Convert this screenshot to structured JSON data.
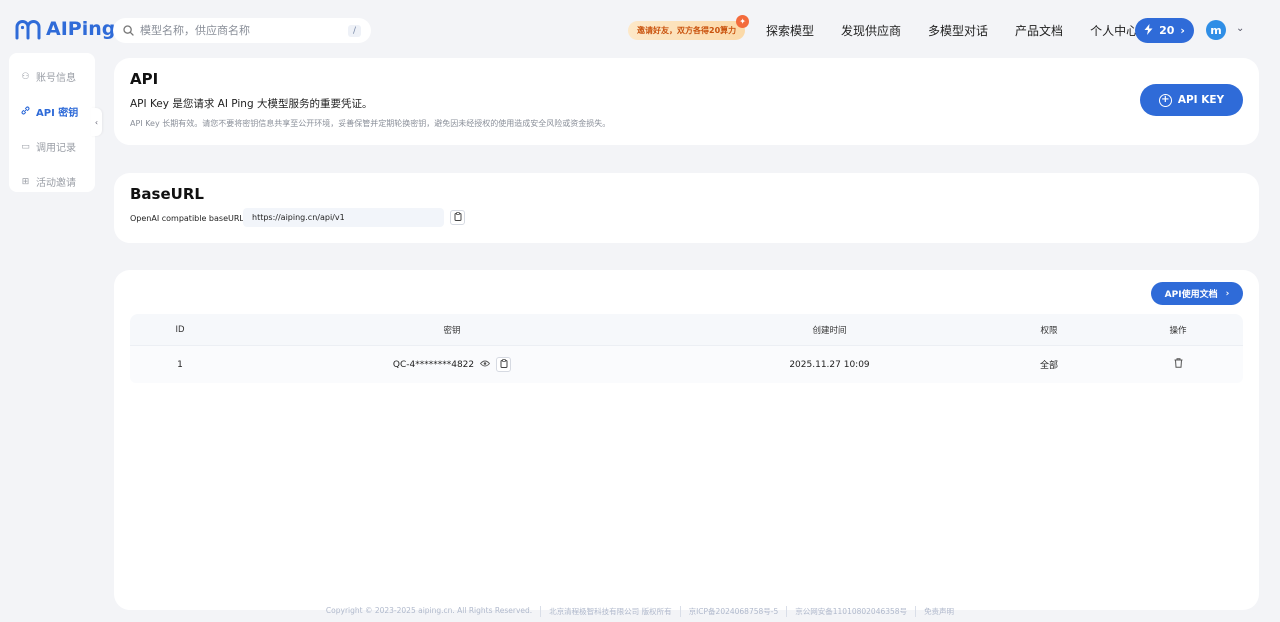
{
  "header": {
    "logo_text": "AIPing",
    "search_placeholder": "模型名称，供应商名称",
    "search_shortcut": "/",
    "promo": "邀请好友，双方各得20算力",
    "nav": [
      "探索模型",
      "发现供应商",
      "多模型对话",
      "产品文档",
      "个人中心"
    ],
    "credits": "20",
    "avatar_letter": "m"
  },
  "sidebar": {
    "items": [
      {
        "label": "账号信息",
        "icon": "users-icon"
      },
      {
        "label": "API 密钥",
        "icon": "link-icon"
      },
      {
        "label": "调用记录",
        "icon": "document-icon"
      },
      {
        "label": "活动邀请",
        "icon": "gift-icon"
      }
    ]
  },
  "api_card": {
    "title": "API",
    "description": "API Key 是您请求 AI Ping 大模型服务的重要凭证。",
    "note": "API Key 长期有效。请您不要将密钥信息共享至公开环境，妥善保管并定期轮换密钥，避免因未经授权的使用造成安全风险或资金损失。",
    "button_label": "API KEY"
  },
  "base_card": {
    "title": "BaseURL",
    "label": "OpenAI compatible baseURL:",
    "url": "https://aiping.cn/api/v1"
  },
  "keys_card": {
    "docs_button": "API使用文档",
    "columns": [
      "ID",
      "密钥",
      "创建时间",
      "权限",
      "操作"
    ],
    "rows": [
      {
        "id": "1",
        "key": "QC-4********4822",
        "created": "2025.11.27 10:09",
        "permission": "全部"
      }
    ]
  },
  "footer": [
    "Copyright © 2023-2025 aiping.cn. All Rights Reserved.",
    "北京清程极智科技有限公司 版权所有",
    "京ICP备2024068758号-5",
    "京公网安备11010802046358号",
    "免责声明"
  ]
}
